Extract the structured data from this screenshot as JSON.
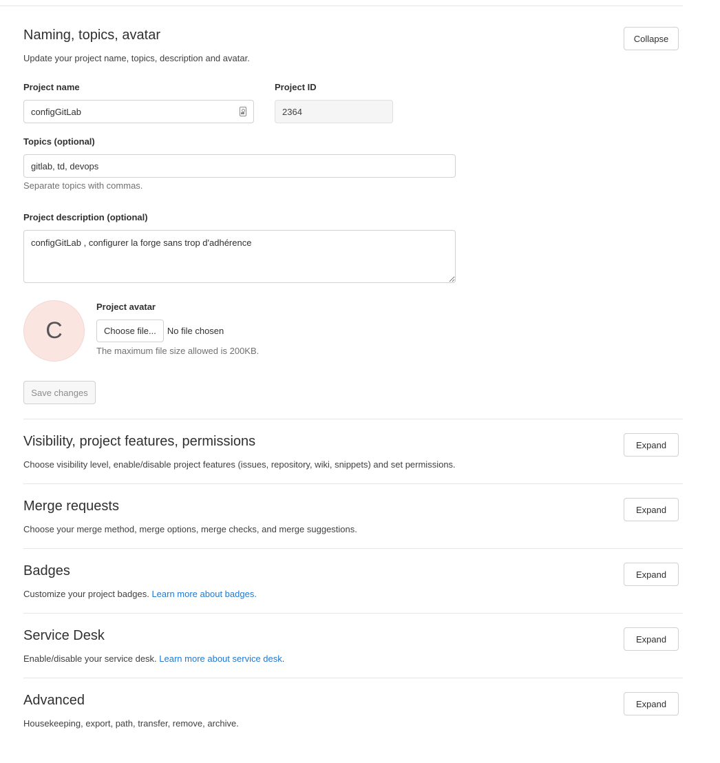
{
  "naming_section": {
    "title": "Naming, topics, avatar",
    "description": "Update your project name, topics, description and avatar.",
    "collapse_label": "Collapse",
    "project_name_label": "Project name",
    "project_name_value": "configGitLab",
    "project_id_label": "Project ID",
    "project_id_value": "2364",
    "topics_label": "Topics (optional)",
    "topics_value": "gitlab, td, devops",
    "topics_help": "Separate topics with commas.",
    "description_label": "Project description (optional)",
    "description_value": "configGitLab , configurer la forge sans trop d'adhérence",
    "avatar_label": "Project avatar",
    "avatar_letter": "C",
    "choose_file_label": "Choose file...",
    "no_file_label": "No file chosen",
    "max_file_help": "The maximum file size allowed is 200KB.",
    "save_label": "Save changes"
  },
  "sections": [
    {
      "id": "visibility",
      "title": "Visibility, project features, permissions",
      "description": "Choose visibility level, enable/disable project features (issues, repository, wiki, snippets) and set permissions.",
      "link": "",
      "suffix": "",
      "button": "Expand"
    },
    {
      "id": "merge-requests",
      "title": "Merge requests",
      "description": "Choose your merge method, merge options, merge checks, and merge suggestions.",
      "link": "",
      "suffix": "",
      "button": "Expand"
    },
    {
      "id": "badges",
      "title": "Badges",
      "description": "Customize your project badges. ",
      "link": "Learn more about badges.",
      "suffix": "",
      "button": "Expand"
    },
    {
      "id": "service-desk",
      "title": "Service Desk",
      "description": "Enable/disable your service desk. ",
      "link": "Learn more about service desk",
      "suffix": ".",
      "button": "Expand"
    },
    {
      "id": "advanced",
      "title": "Advanced",
      "description": "Housekeeping, export, path, transfer, remove, archive.",
      "link": "",
      "suffix": "",
      "button": "Expand"
    }
  ],
  "colors": {
    "link": "#1f78d1",
    "avatar_bg": "#fbe5e1",
    "border": "#e5e5e5"
  }
}
